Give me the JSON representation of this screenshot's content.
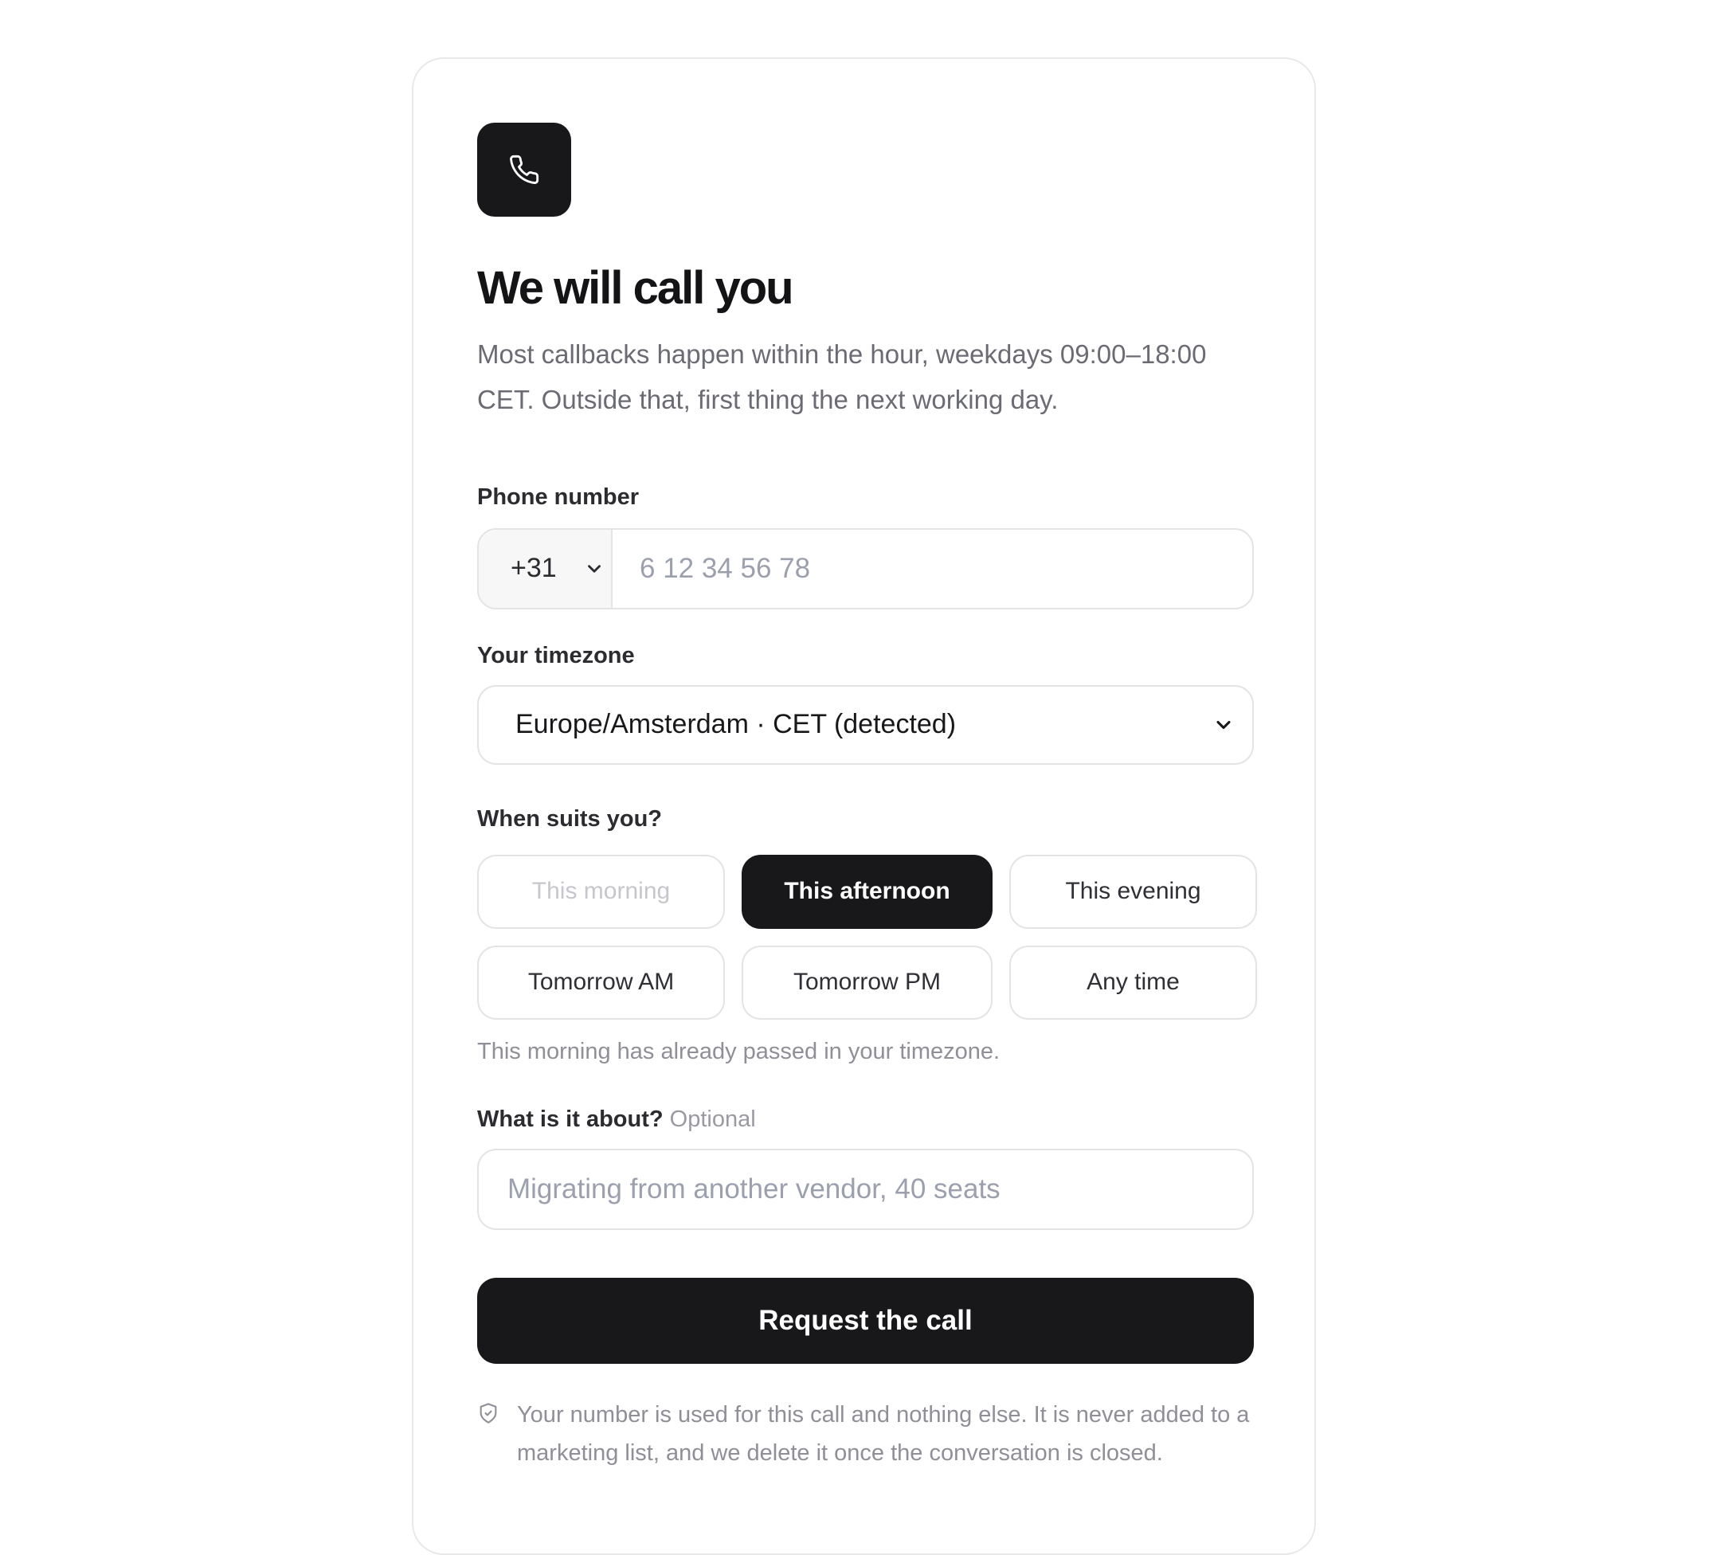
{
  "header": {
    "logo_icon": "phone-icon",
    "title": "We will call you",
    "subtitle": "Most callbacks happen within the hour, weekdays 09:00–18:00 CET. Outside that, first thing the next working day."
  },
  "phone": {
    "label": "Phone number",
    "country_code": "+31",
    "placeholder": "6 12 34 56 78",
    "value": ""
  },
  "timezone": {
    "label": "Your timezone",
    "selected": "Europe/Amsterdam · CET (detected)"
  },
  "when": {
    "label": "When suits you?",
    "slots": [
      {
        "label": "This morning",
        "state": "disabled"
      },
      {
        "label": "This afternoon",
        "state": "selected"
      },
      {
        "label": "This evening",
        "state": "default"
      },
      {
        "label": "Tomorrow AM",
        "state": "default"
      },
      {
        "label": "Tomorrow PM",
        "state": "default"
      },
      {
        "label": "Any time",
        "state": "default"
      }
    ],
    "hint": "This morning has already passed in your timezone."
  },
  "about": {
    "label": "What is it about?",
    "optional": "Optional",
    "placeholder": "Migrating from another vendor, 40 seats",
    "value": ""
  },
  "submit": {
    "label": "Request the call"
  },
  "privacy": {
    "icon": "shield-check-icon",
    "text": "Your number is used for this call and nothing else. It is never added to a marketing list, and we delete it once the conversation is closed."
  },
  "colors": {
    "primary": "#18181b",
    "border": "#e4e4e7",
    "muted_text": "#8f8f97",
    "placeholder": "#9ca0ad"
  }
}
